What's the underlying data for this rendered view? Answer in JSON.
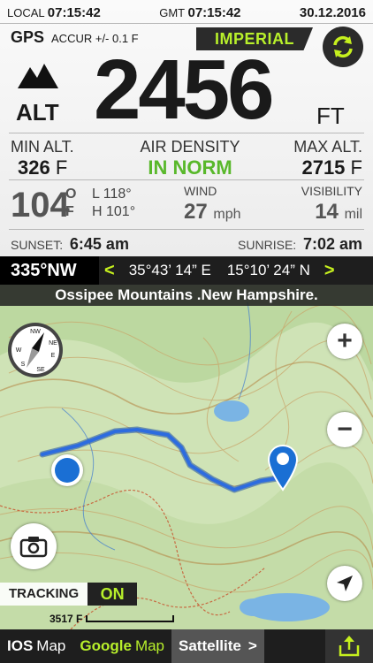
{
  "header": {
    "local_label": "LOCAL",
    "local_time": "07:15:42",
    "gmt_label": "GMT",
    "gmt_time": "07:15:42",
    "date": "30.12.2016"
  },
  "gps": {
    "label": "GPS",
    "accuracy": "ACCUR +/- 0.1 F",
    "units_button": "IMPERIAL"
  },
  "altitude": {
    "label": "ALT",
    "value": "2456",
    "unit": "FT"
  },
  "stats": {
    "min_label": "MIN ALT.",
    "min_value": "326",
    "min_unit": "F",
    "density_label": "AIR DENSITY",
    "density_value": "IN NORM",
    "max_label": "MAX ALT.",
    "max_value": "2715",
    "max_unit": "F"
  },
  "weather": {
    "temp": "104",
    "temp_unit_o": "O",
    "temp_unit_f": "F",
    "low": "L 118°",
    "high": "H 101°",
    "wind_label": "WIND",
    "wind_value": "27",
    "wind_unit": "mph",
    "vis_label": "VISIBILITY",
    "vis_value": "14",
    "vis_unit": "mil"
  },
  "sun": {
    "sunset_label": "SUNSET:",
    "sunset_time": "6:45 am",
    "sunrise_label": "SUNRISE:",
    "sunrise_time": "7:02 am"
  },
  "coords": {
    "heading": "335°NW",
    "prev": "<",
    "lat": "35°43’ 14” E",
    "lon": "15°10’ 24” N",
    "next": ">"
  },
  "map": {
    "location": "Ossipee Mountains .New Hampshire.",
    "zoom_in": "+",
    "zoom_out": "−",
    "tracking_label": "TRACKING",
    "tracking_state": "ON",
    "scale_value": "3517 F"
  },
  "bottom": {
    "ios_bold": "IOS",
    "ios_rest": "Map",
    "google_bold": "Google",
    "google_rest": "Map",
    "satellite": "Sattellite",
    "satellite_arrow": ">"
  },
  "colors": {
    "accent": "#b8f02b",
    "route": "#1c5fd6",
    "map_bg": "#cfe3b6"
  }
}
